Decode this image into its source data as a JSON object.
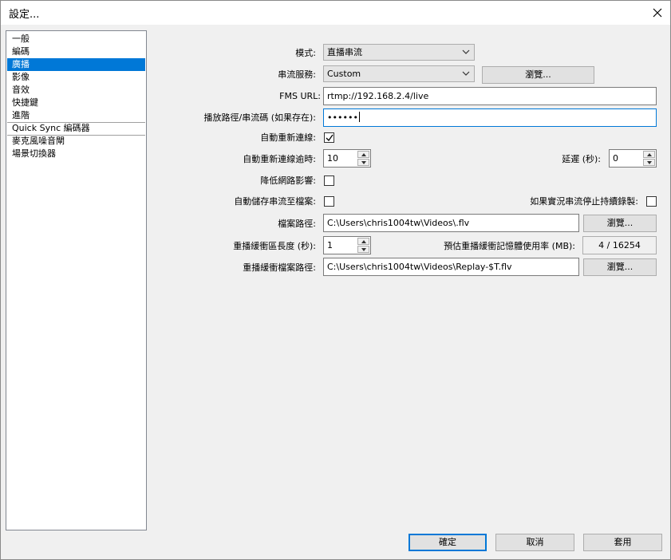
{
  "window": {
    "title": "設定..."
  },
  "sidebar": {
    "items": [
      {
        "label": "一般"
      },
      {
        "label": "編碼"
      },
      {
        "label": "廣播",
        "selected": true
      },
      {
        "label": "影像"
      },
      {
        "label": "音效"
      },
      {
        "label": "快捷鍵"
      },
      {
        "label": "進階"
      },
      {
        "label": "Quick Sync 編碼器"
      },
      {
        "label": "麥克風噪音閘"
      },
      {
        "label": "場景切換器"
      }
    ]
  },
  "broadcast": {
    "mode_label": "模式:",
    "mode_value": "直播串流",
    "service_label": "串流服務:",
    "service_value": "Custom",
    "service_browse": "瀏覽...",
    "fms_label": "FMS URL:",
    "fms_value": "rtmp://192.168.2.4/live",
    "playpath_label": "播放路徑/串流碼 (如果存在):",
    "playpath_value": "••••••",
    "auto_reconnect_label": "自動重新連線:",
    "auto_reconnect_checked": true,
    "reconnect_timeout_label": "自動重新連線逾時:",
    "reconnect_timeout_value": "10",
    "delay_label": "延遲 (秒):",
    "delay_value": "0",
    "min_latency_label": "降低網路影響:",
    "min_latency_checked": false,
    "save_to_file_label": "自動儲存串流至檔案:",
    "save_to_file_checked": false,
    "keep_recording_label": "如果實況串流停止持續錄製:",
    "keep_recording_checked": false,
    "file_path_label": "檔案路徑:",
    "file_path_value": "C:\\Users\\chris1004tw\\Videos\\.flv",
    "file_path_browse": "瀏覽...",
    "replay_length_label": "重播緩衝區長度 (秒):",
    "replay_length_value": "1",
    "replay_memory_label": "預估重播緩衝記憶體使用率 (MB):",
    "replay_memory_value": "4 / 16254",
    "replay_path_label": "重播緩衝檔案路徑:",
    "replay_path_value": "C:\\Users\\chris1004tw\\Videos\\Replay-$T.flv",
    "replay_path_browse": "瀏覽..."
  },
  "footer": {
    "ok": "確定",
    "cancel": "取消",
    "apply": "套用"
  },
  "colors": {
    "accent": "#0078d7",
    "selected_bg": "#0078d7"
  }
}
